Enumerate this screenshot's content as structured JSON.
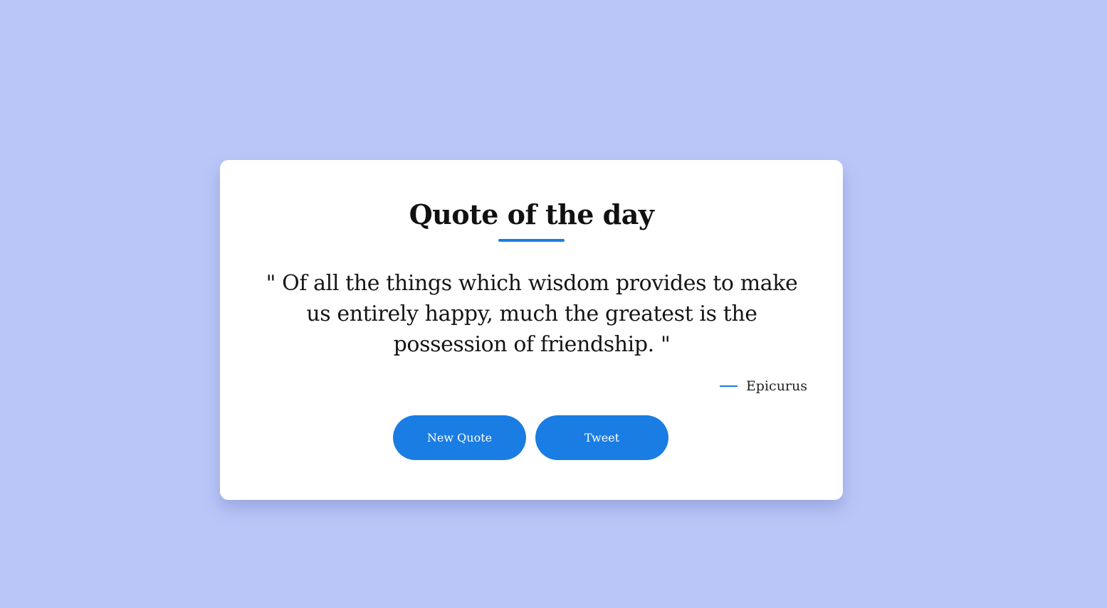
{
  "card": {
    "title": "Quote of the day",
    "quote": "\" Of all the things which wisdom provides to make us entirely happy, much the greatest is the possession of friendship. \"",
    "author": "Epicurus"
  },
  "buttons": {
    "new_quote_label": "New Quote",
    "tweet_label": "Tweet"
  },
  "colors": {
    "background": "#bac6f8",
    "card": "#ffffff",
    "accent": "#1a7de3",
    "text": "#111111"
  }
}
